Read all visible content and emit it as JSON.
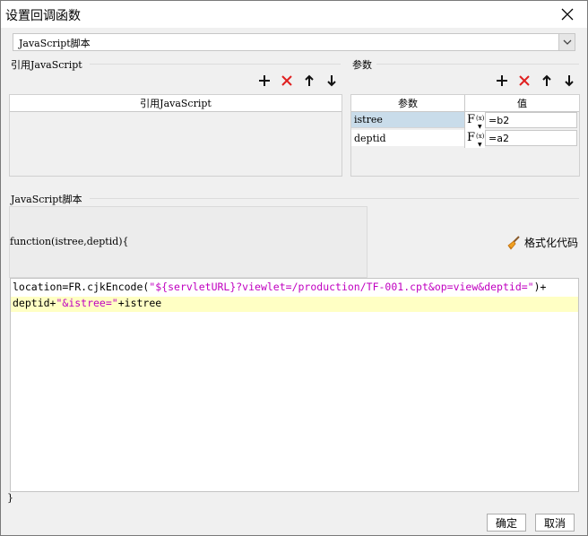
{
  "window": {
    "title": "设置回调函数"
  },
  "script_type_select": {
    "value": "JavaScript脚本"
  },
  "ref_section": {
    "label": "引用JavaScript",
    "table_header": "引用JavaScript"
  },
  "params_section": {
    "label": "参数",
    "columns": [
      "参数",
      "值"
    ],
    "rows": [
      {
        "name": "istree",
        "value": "=b2"
      },
      {
        "name": "deptid",
        "value": "=a2"
      }
    ]
  },
  "script_section": {
    "label": "JavaScript脚本",
    "function_signature": "function(istree,deptid){",
    "closing": "}",
    "format_button": "格式化代码"
  },
  "code": {
    "line1_a": "location=FR.cjkEncode(",
    "line1_str": "\"${servletURL}?viewlet=/production/TF-001.cpt&op=view&deptid=\"",
    "line1_b": ")+",
    "line2_a": "deptid+",
    "line2_str": "\"&istree=\"",
    "line2_b": "+istree"
  },
  "footer": {
    "ok": "确定",
    "cancel": "取消"
  },
  "colors": {
    "delete": "#e02020",
    "string": "#c000c0",
    "highlight_line": "#ffffc4",
    "selected_cell": "#c9dcea"
  }
}
